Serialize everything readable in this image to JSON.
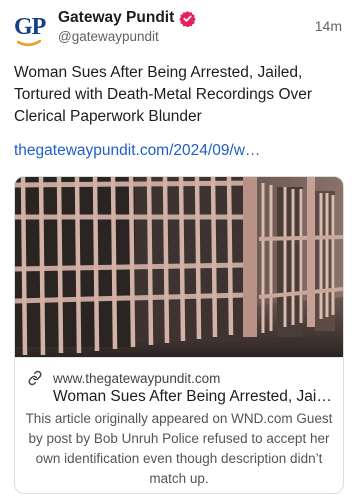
{
  "post": {
    "author_name": "Gateway Pundit",
    "avatar_text": "GP",
    "handle": "@gatewaypundit",
    "time": "14m",
    "text": "Woman Sues After Being Arrested, Jailed, Tortured with Death-Metal Recordings Over Clerical Paperwork Blunder",
    "link_text": "thegatewaypundit.com/2024/09/w…"
  },
  "card": {
    "domain": "www.thegatewaypundit.com",
    "title": "Woman Sues After Being Arrested, Jai…",
    "description": "This article originally appeared on WND.com Guest by post by Bob Unruh Police refused to accept her own identification even though description didn’t match up."
  },
  "colors": {
    "link": "#1e5fc9",
    "brand_blue": "#16408c",
    "brand_orange": "#f0a020",
    "verified_badge": "#e0245e"
  },
  "icons": {
    "verified": "verified-badge-icon",
    "link": "link-icon"
  }
}
